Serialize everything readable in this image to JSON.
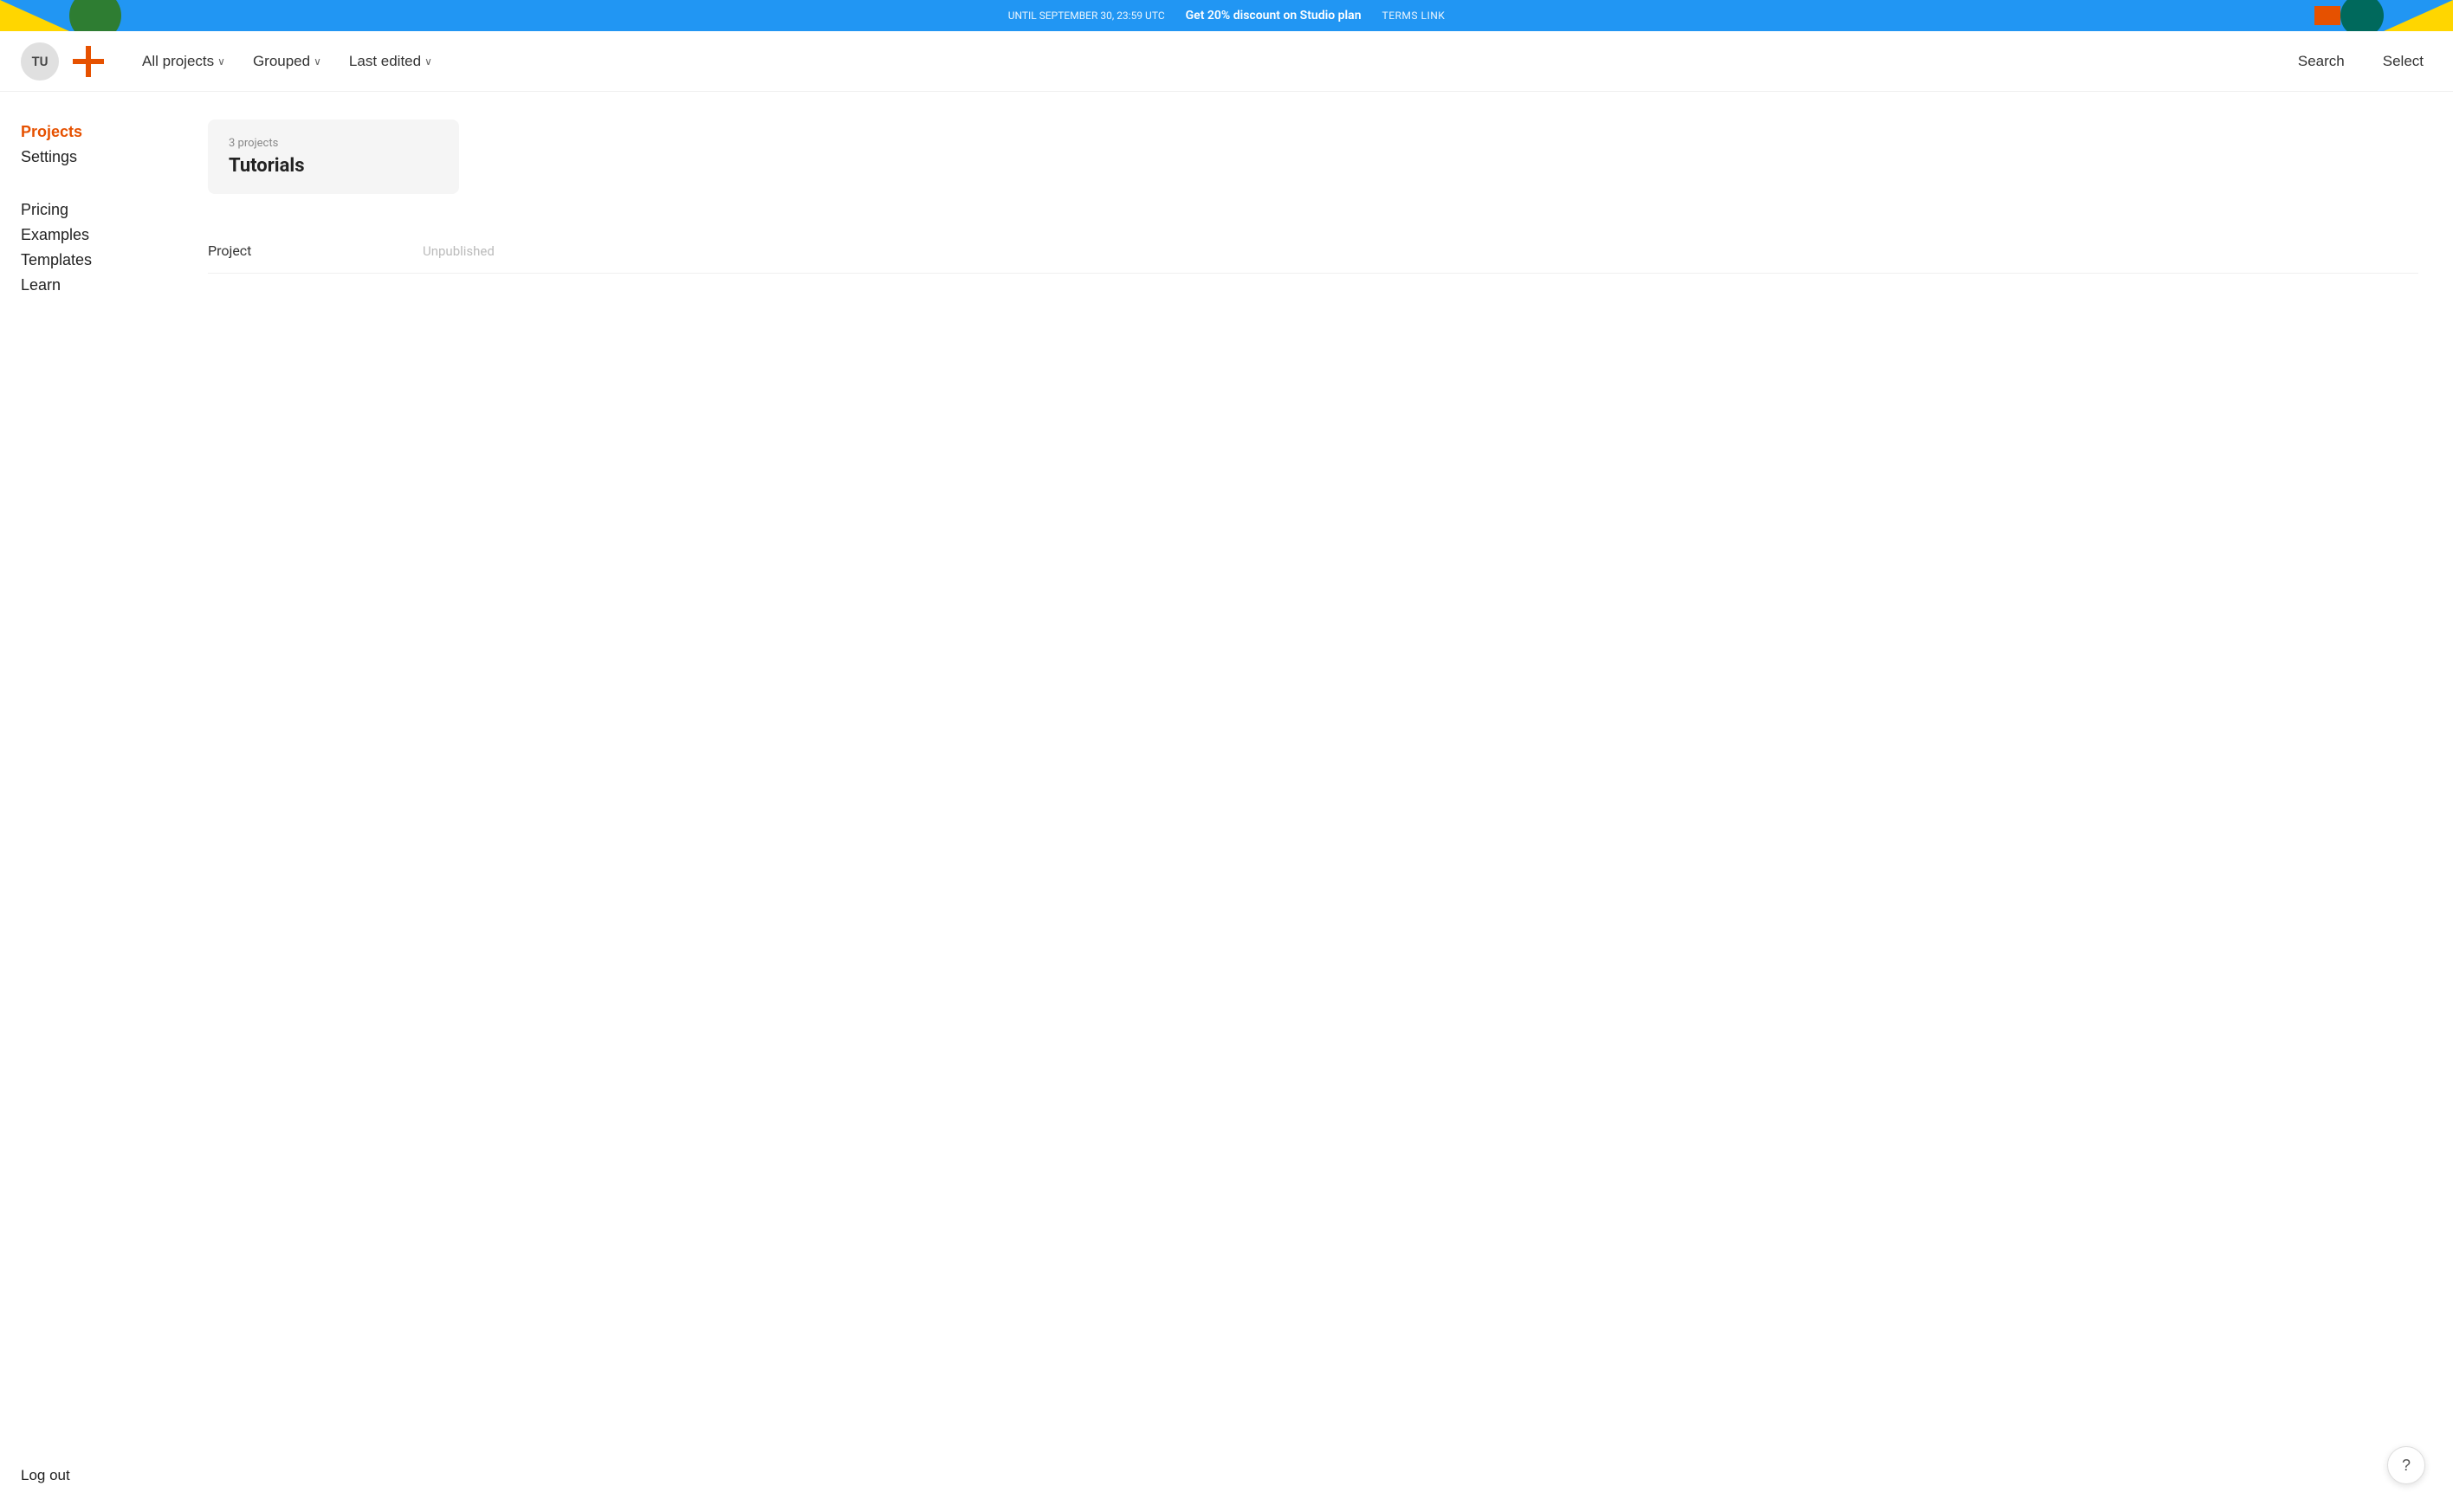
{
  "banner": {
    "until_text": "UNTIL SEPTEMBER 30, 23:59 UTC",
    "offer_text": "Get 20% discount on Studio plan",
    "terms_text": "TERMS LINK"
  },
  "nav": {
    "avatar_initials": "TU",
    "add_button_label": "+",
    "filter_all_projects": "All projects",
    "filter_grouped": "Grouped",
    "filter_last_edited": "Last edited",
    "search_label": "Search",
    "select_label": "Select"
  },
  "sidebar": {
    "items": [
      {
        "label": "Projects",
        "id": "projects",
        "active": true
      },
      {
        "label": "Settings",
        "id": "settings",
        "active": false
      }
    ],
    "secondary_items": [
      {
        "label": "Pricing",
        "id": "pricing"
      },
      {
        "label": "Examples",
        "id": "examples"
      },
      {
        "label": "Templates",
        "id": "templates"
      },
      {
        "label": "Learn",
        "id": "learn"
      }
    ],
    "logout_label": "Log out"
  },
  "main": {
    "group": {
      "meta": "3 projects",
      "title": "Tutorials"
    },
    "project_row": {
      "name": "Project",
      "status": "Unpublished"
    }
  },
  "help": {
    "label": "?"
  }
}
